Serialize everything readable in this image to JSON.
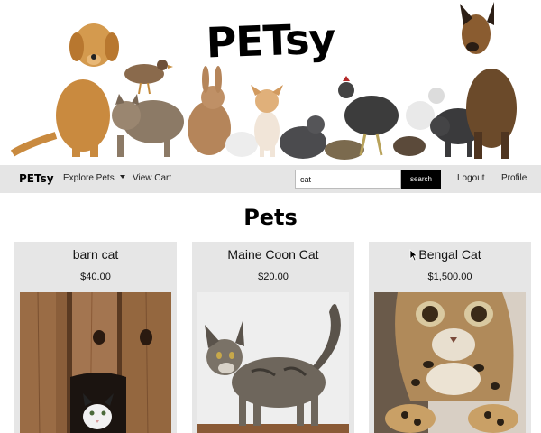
{
  "hero": {
    "brand_title": "PETsy"
  },
  "navbar": {
    "logo": "PETsy",
    "explore_label": "Explore Pets",
    "cart_label": "View Cart",
    "search": {
      "value": "cat",
      "button_label": "search"
    },
    "logout_label": "Logout",
    "profile_label": "Profile",
    "background": "#e5e5e5"
  },
  "main": {
    "page_title": "Pets",
    "cards": [
      {
        "name": "barn cat",
        "price": "$40.00"
      },
      {
        "name": "Maine Coon Cat",
        "price": "$20.00"
      },
      {
        "name": "Bengal Cat",
        "price": "$1,500.00"
      }
    ]
  }
}
